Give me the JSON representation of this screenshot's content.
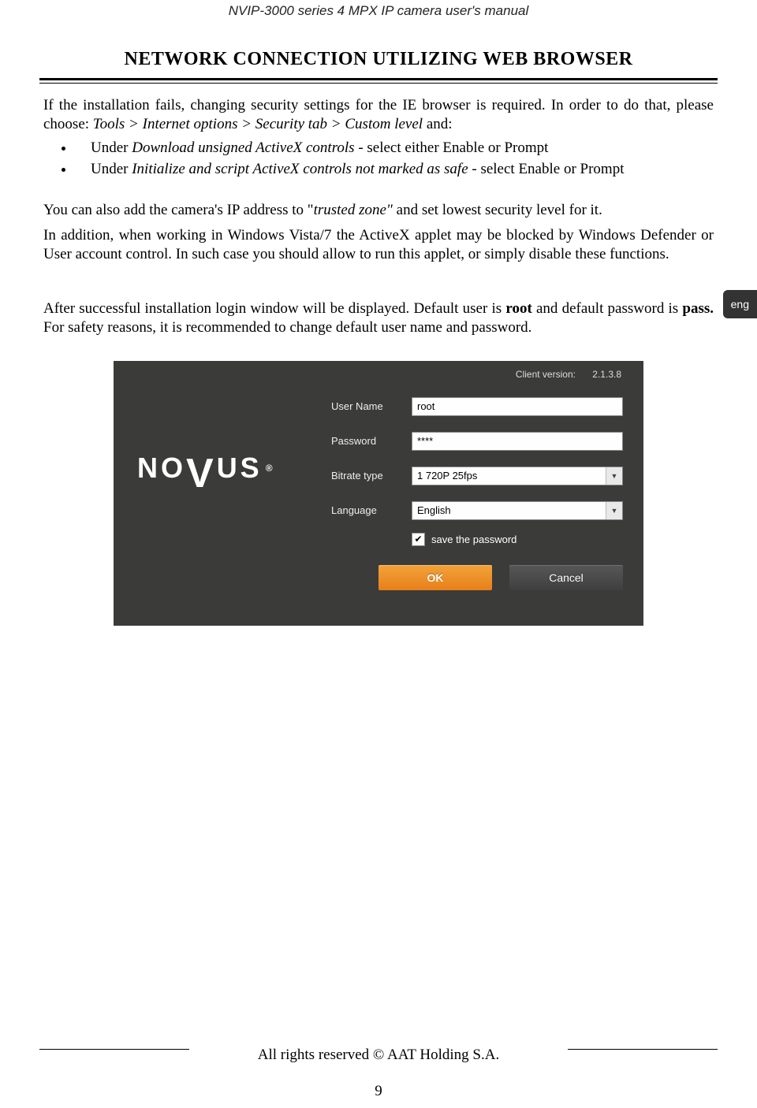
{
  "running_header": "NVIP-3000 series 4 MPX IP camera user's manual",
  "section_title": "NETWORK CONNECTION UTILIZING WEB BROWSER",
  "lang_tab": "eng",
  "para1_a": "If the installation fails, changing security settings for the IE browser is required. In order to do that, please choose: ",
  "para1_b": "Tools > Internet options > Security tab > Custom level",
  "para1_c": " and:",
  "bullet1_a": "Under ",
  "bullet1_b": "Download unsigned ActiveX controls",
  "bullet1_c": " - select either Enable or Prompt",
  "bullet2_a": "Under ",
  "bullet2_b": "Initialize and script ActiveX controls not marked as safe",
  "bullet2_c": " - select Enable or Prompt",
  "para2_a": "You can also add the camera's IP address to \"",
  "para2_b": "trusted zone\"",
  "para2_c": " and set lowest security level for it.",
  "para3": "In addition, when working in Windows Vista/7 the ActiveX applet may be blocked by Windows Defender or User account control. In such case you should allow to run this applet, or simply disable these functions.",
  "para4_a": "After successful installation login window will be displayed. Default user is ",
  "para4_b": "root",
  "para4_c": " and default password is ",
  "para4_d": "pass.",
  "para4_e": " For safety reasons, it is recommended to change default user name and password.",
  "login": {
    "client_version_label": "Client version:",
    "client_version_value": "2.1.3.8",
    "logo_pre": "NO",
    "logo_v": "V",
    "logo_post": "US",
    "logo_reg": "®",
    "labels": {
      "username": "User Name",
      "password": "Password",
      "bitrate": "Bitrate type",
      "language": "Language"
    },
    "values": {
      "username": "root",
      "password": "****",
      "bitrate": "1 720P 25fps",
      "language": "English"
    },
    "save_pw": "save the password",
    "check": "✔",
    "ok": "OK",
    "cancel": "Cancel"
  },
  "footer": "All rights reserved © AAT Holding S.A.",
  "page_number": "9"
}
